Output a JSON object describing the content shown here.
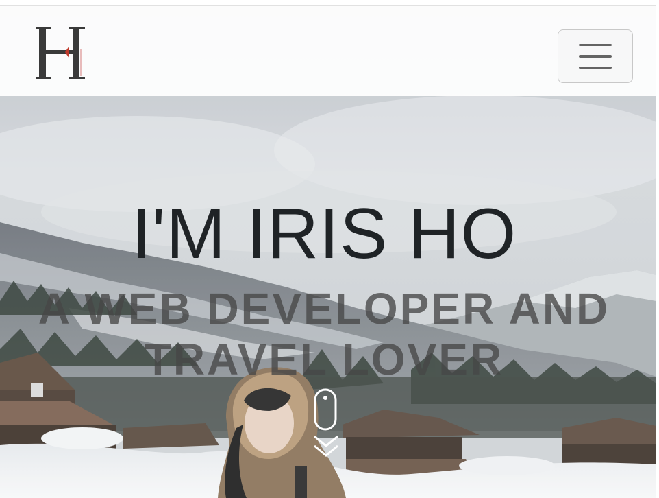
{
  "brand": {
    "logo_letter": "H",
    "logo_alt_icon": "monogram-logo"
  },
  "navbar": {
    "toggle_icon": "hamburger-menu-icon",
    "toggle_label": "Toggle navigation"
  },
  "hero": {
    "title": "I'M IRIS HO",
    "subtitle": "A WEB DEVELOPER AND TRAVEL LOVER",
    "scroll_icon": "mouse-scroll-icon",
    "scroll_arrow_icon": "double-chevron-down-icon"
  },
  "colors": {
    "title": "#1f2326",
    "subtitle": "#464646",
    "logo_dark": "#3a3a3a",
    "logo_accent": "#c0392b"
  }
}
